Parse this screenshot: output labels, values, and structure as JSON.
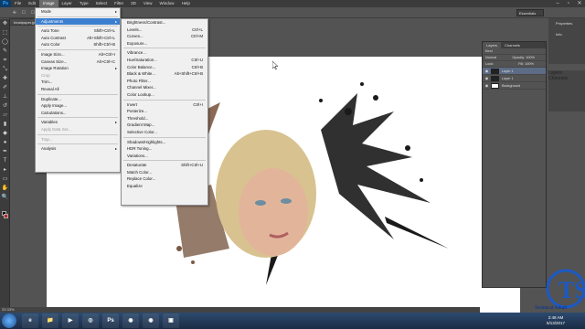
{
  "app": {
    "logo": "Ps"
  },
  "menubar": [
    "File",
    "Edit",
    "Image",
    "Layer",
    "Type",
    "Select",
    "Filter",
    "3D",
    "View",
    "Window",
    "Help"
  ],
  "active_menu": "Image",
  "options_bar": {
    "label": "Essentials"
  },
  "doc_tab": "headpaper.jpg @ 33.3% (Layer 1, RGB/8#)",
  "status": "33.33%",
  "image_menu": {
    "items": [
      {
        "label": "Mode",
        "shortcut": "",
        "arrow": true,
        "hl": false,
        "dis": false
      },
      {
        "sep": true
      },
      {
        "label": "Adjustments",
        "shortcut": "",
        "arrow": true,
        "hl": true,
        "dis": false
      },
      {
        "sep": true
      },
      {
        "label": "Auto Tone",
        "shortcut": "Shift+Ctrl+L",
        "hl": false,
        "dis": false
      },
      {
        "label": "Auto Contrast",
        "shortcut": "Alt+Shift+Ctrl+L",
        "hl": false,
        "dis": false
      },
      {
        "label": "Auto Color",
        "shortcut": "Shift+Ctrl+B",
        "hl": false,
        "dis": false
      },
      {
        "sep": true
      },
      {
        "label": "Image Size...",
        "shortcut": "Alt+Ctrl+I",
        "hl": false,
        "dis": false
      },
      {
        "label": "Canvas Size...",
        "shortcut": "Alt+Ctrl+C",
        "hl": false,
        "dis": false
      },
      {
        "label": "Image Rotation",
        "shortcut": "",
        "arrow": true,
        "hl": false,
        "dis": false
      },
      {
        "label": "Crop",
        "shortcut": "",
        "hl": false,
        "dis": true
      },
      {
        "label": "Trim...",
        "shortcut": "",
        "hl": false,
        "dis": false
      },
      {
        "label": "Reveal All",
        "shortcut": "",
        "hl": false,
        "dis": false
      },
      {
        "sep": true
      },
      {
        "label": "Duplicate...",
        "shortcut": "",
        "hl": false,
        "dis": false
      },
      {
        "label": "Apply Image...",
        "shortcut": "",
        "hl": false,
        "dis": false
      },
      {
        "label": "Calculations...",
        "shortcut": "",
        "hl": false,
        "dis": false
      },
      {
        "sep": true
      },
      {
        "label": "Variables",
        "shortcut": "",
        "arrow": true,
        "hl": false,
        "dis": false
      },
      {
        "label": "Apply Data Set...",
        "shortcut": "",
        "hl": false,
        "dis": true
      },
      {
        "sep": true
      },
      {
        "label": "Trap...",
        "shortcut": "",
        "hl": false,
        "dis": true
      },
      {
        "sep": true
      },
      {
        "label": "Analysis",
        "shortcut": "",
        "arrow": true,
        "hl": false,
        "dis": false
      }
    ]
  },
  "adjustments_menu": {
    "items": [
      {
        "label": "Brightness/Contrast...",
        "shortcut": ""
      },
      {
        "label": "Levels...",
        "shortcut": "Ctrl+L"
      },
      {
        "label": "Curves...",
        "shortcut": "Ctrl+M"
      },
      {
        "label": "Exposure...",
        "shortcut": ""
      },
      {
        "sep": true
      },
      {
        "label": "Vibrance...",
        "shortcut": ""
      },
      {
        "label": "Hue/Saturation...",
        "shortcut": "Ctrl+U"
      },
      {
        "label": "Color Balance...",
        "shortcut": "Ctrl+B"
      },
      {
        "label": "Black & White...",
        "shortcut": "Alt+Shift+Ctrl+B"
      },
      {
        "label": "Photo Filter...",
        "shortcut": ""
      },
      {
        "label": "Channel Mixer...",
        "shortcut": ""
      },
      {
        "label": "Color Lookup...",
        "shortcut": ""
      },
      {
        "sep": true
      },
      {
        "label": "Invert",
        "shortcut": "Ctrl+I"
      },
      {
        "label": "Posterize...",
        "shortcut": ""
      },
      {
        "label": "Threshold...",
        "shortcut": ""
      },
      {
        "label": "Gradient Map...",
        "shortcut": ""
      },
      {
        "label": "Selective Color...",
        "shortcut": ""
      },
      {
        "sep": true
      },
      {
        "label": "Shadows/Highlights...",
        "shortcut": ""
      },
      {
        "label": "HDR Toning...",
        "shortcut": ""
      },
      {
        "label": "Variations...",
        "shortcut": ""
      },
      {
        "sep": true
      },
      {
        "label": "Desaturate",
        "shortcut": "Shift+Ctrl+U"
      },
      {
        "label": "Match Color...",
        "shortcut": ""
      },
      {
        "label": "Replace Color...",
        "shortcut": ""
      },
      {
        "label": "Equalize",
        "shortcut": ""
      }
    ]
  },
  "right_panels": [
    "Properties",
    "Info",
    "Layers",
    "Channels"
  ],
  "layers_panel": {
    "tabs": [
      "Layers",
      "Channels"
    ],
    "kind": "Kind",
    "blend": "Normal",
    "opacity_label": "Opacity:",
    "opacity": "100%",
    "lock_label": "Lock:",
    "fill_label": "Fill:",
    "fill": "100%",
    "layers": [
      {
        "name": "Layer 1",
        "selected": true,
        "dark": true
      },
      {
        "name": "Layer 1",
        "selected": false,
        "dark": true
      },
      {
        "name": "Background",
        "selected": false,
        "dark": false
      }
    ]
  },
  "clock": {
    "time": "2:48 AM",
    "date": "5/13/2017"
  },
  "watermark": "Technical Sohail",
  "taskbar_apps": [
    "e",
    "📁",
    "▶",
    "◎",
    "Ps",
    "◉",
    "◉",
    "▣"
  ],
  "colors": {
    "highlight": "#3c7fd0",
    "panel": "#535353",
    "menubar": "#3b3b3b"
  }
}
